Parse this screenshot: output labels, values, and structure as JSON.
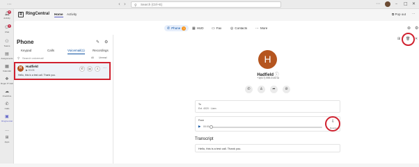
{
  "titlebar": {
    "search_placeholder": "Search (Ctrl+E)"
  },
  "rail": [
    {
      "label": "Activity",
      "icon": "bell-icon",
      "badge": "8"
    },
    {
      "label": "Chat",
      "icon": "chat-icon",
      "badge": "2"
    },
    {
      "label": "Teams",
      "icon": "teams-icon",
      "badge": ""
    },
    {
      "label": "Assignments",
      "icon": "assignments-icon",
      "badge": ""
    },
    {
      "label": "Calendar",
      "icon": "calendar-icon",
      "badge": ""
    },
    {
      "label": "Roger IT Hub",
      "icon": "hub-icon",
      "badge": ""
    },
    {
      "label": "OneDrive",
      "icon": "cloud-icon",
      "badge": ""
    },
    {
      "label": "Calls",
      "icon": "phone-icon",
      "badge": ""
    },
    {
      "label": "RingCentral",
      "icon": "ringcentral-icon",
      "badge": ""
    },
    {
      "label": "...",
      "icon": "more-icon",
      "badge": ""
    },
    {
      "label": "Apps",
      "icon": "apps-icon",
      "badge": ""
    }
  ],
  "app": {
    "name": "RingCentral",
    "logo": "R",
    "tabs": [
      "Home",
      "Activity"
    ],
    "popout": "Pop out"
  },
  "rc_nav": {
    "phone": "Phone",
    "phone_count": "1",
    "hud": "HUD",
    "fax": "Fax",
    "contacts": "Contacts",
    "more": "More"
  },
  "left": {
    "title": "Phone",
    "subtabs": [
      "Keypad",
      "Calls",
      "Voicemail(1)",
      "Recordings"
    ],
    "search_placeholder": "Search voicemail",
    "filter_all": "All",
    "filter_unread": "Unread"
  },
  "voicemail": {
    "avatar": "H",
    "name": "Hadfield",
    "duration": "00:05",
    "preview": "Hello, this is a test call. Thank you."
  },
  "detail": {
    "avatar": "H",
    "name": "Hadfield",
    "number": "+1(617) 555-0143",
    "to_label": "To",
    "to_value": "Ext. 4020 · Liam",
    "from_label": "From",
    "play_time": "00:00",
    "download_label": "Download",
    "transcript_title": "Transcript",
    "transcript_text": "Hello, this is a test call. Thank you."
  }
}
